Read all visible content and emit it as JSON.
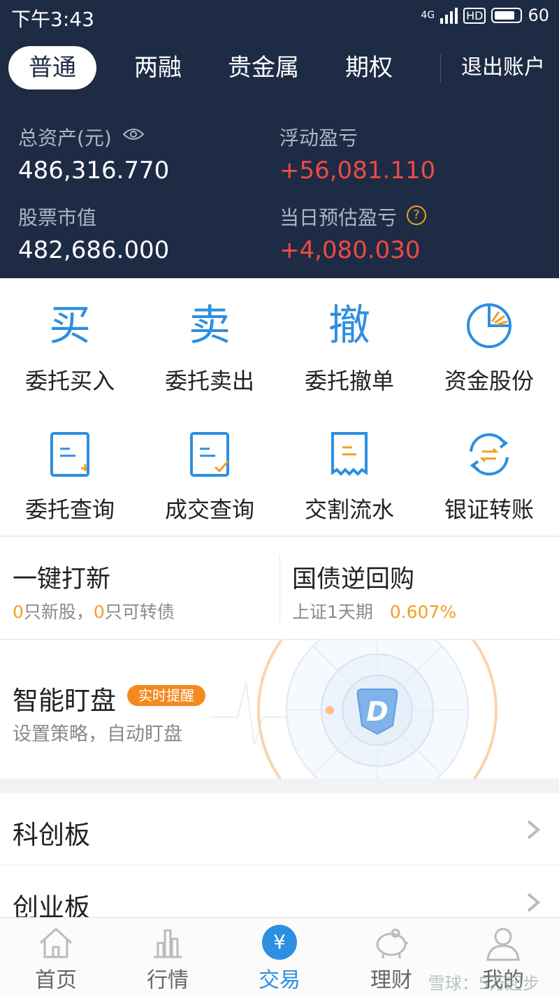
{
  "status": {
    "time": "下午3:43",
    "net": "4G",
    "hd": "HD",
    "battery": "60"
  },
  "account_tabs": [
    "普通",
    "两融",
    "贵金属",
    "期权"
  ],
  "logout": "退出账户",
  "assets": {
    "total_label": "总资产(元)",
    "total_value": "486,316.770",
    "float_label": "浮动盈亏",
    "float_value": "+56,081.110",
    "stock_label": "股票市值",
    "stock_value": "482,686.000",
    "daily_label": "当日预估盈亏",
    "daily_value": "+4,080.030",
    "help_glyph": "?"
  },
  "functions": [
    {
      "label": "委托买入",
      "glyph": "买",
      "icon": "buy-icon"
    },
    {
      "label": "委托卖出",
      "glyph": "卖",
      "icon": "sell-icon"
    },
    {
      "label": "委托撤单",
      "glyph": "撤",
      "icon": "cancel-icon"
    },
    {
      "label": "资金股份",
      "icon": "pie-chart-icon"
    },
    {
      "label": "委托查询",
      "icon": "order-query-icon"
    },
    {
      "label": "成交查询",
      "icon": "deal-query-icon"
    },
    {
      "label": "交割流水",
      "icon": "receipt-icon"
    },
    {
      "label": "银证转账",
      "icon": "transfer-icon"
    }
  ],
  "quick": {
    "ipo_title": "一键打新",
    "ipo_count1": "0",
    "ipo_text1": "只新股，",
    "ipo_count2": "0",
    "ipo_text2": "只可转债",
    "repo_title": "国债逆回购",
    "repo_sub": "上证1天期",
    "repo_rate": "0.607%"
  },
  "banner": {
    "title": "智能盯盘",
    "badge": "实时提醒",
    "sub": "设置策略，自动盯盘",
    "logo_letter": "D"
  },
  "list": [
    "科创板",
    "创业板"
  ],
  "nav": [
    {
      "label": "首页",
      "icon": "home-icon"
    },
    {
      "label": "行情",
      "icon": "market-icon"
    },
    {
      "label": "交易",
      "icon": "trade-icon",
      "glyph": "¥"
    },
    {
      "label": "理财",
      "icon": "piggy-bank-icon"
    },
    {
      "label": "我的",
      "icon": "user-icon"
    }
  ],
  "watermark": "雪球：5万起步",
  "colors": {
    "header_bg": "#1e2b45",
    "accent": "#2d8fe0",
    "profit": "#ef4a43",
    "orange": "#f0a021"
  }
}
